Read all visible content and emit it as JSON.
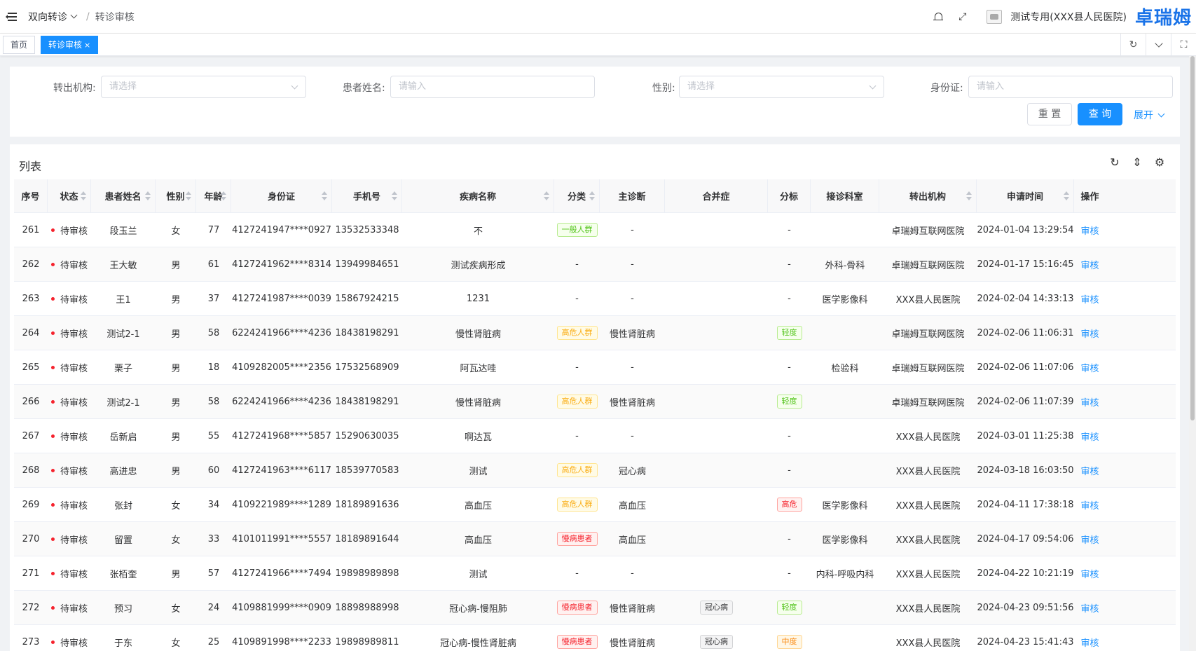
{
  "header": {
    "breadcrumb_parent": "双向转诊",
    "breadcrumb_current": "转诊审核",
    "org_name": "测试专用(XXX县人民医院)",
    "brand": "卓瑞姆"
  },
  "tabs": {
    "home": "首页",
    "active": "转诊审核",
    "close": "×"
  },
  "search": {
    "org_label": "转出机构:",
    "org_placeholder": "请选择",
    "name_label": "患者姓名:",
    "name_placeholder": "请输入",
    "gender_label": "性别:",
    "gender_placeholder": "请选择",
    "id_label": "身份证:",
    "id_placeholder": "请输入",
    "reset": "重 置",
    "query": "查 询",
    "expand": "展开"
  },
  "list": {
    "title": "列表",
    "columns": [
      "序号",
      "状态",
      "患者姓名",
      "性别",
      "年龄",
      "身份证",
      "手机号",
      "疾病名称",
      "分类",
      "主诊断",
      "合并症",
      "分标",
      "接诊科室",
      "转出机构",
      "申请时间",
      "操作"
    ],
    "rows": [
      {
        "no": "261",
        "status": "待审核",
        "name": "段玉兰",
        "gender": "女",
        "age": "77",
        "idcard": "4127241947****0927",
        "phone": "13532533348",
        "disease": "不",
        "category": "一般人群",
        "cat_color": "green",
        "diag": "-",
        "comorb": "",
        "grade": "-",
        "grade_color": "",
        "dept": "",
        "org": "卓瑞姆互联网医院",
        "time": "2024-01-04 13:29:54",
        "action": "审核"
      },
      {
        "no": "262",
        "status": "待审核",
        "name": "王大敏",
        "gender": "男",
        "age": "61",
        "idcard": "4127241962****8314",
        "phone": "13949984651",
        "disease": "测试疾病形成",
        "category": "-",
        "cat_color": "",
        "diag": "-",
        "comorb": "",
        "grade": "-",
        "grade_color": "",
        "dept": "外科-骨科",
        "org": "卓瑞姆互联网医院",
        "time": "2024-01-17 15:16:45",
        "action": "审核"
      },
      {
        "no": "263",
        "status": "待审核",
        "name": "王1",
        "gender": "男",
        "age": "37",
        "idcard": "4127241987****0039",
        "phone": "15867924215",
        "disease": "1231",
        "category": "-",
        "cat_color": "",
        "diag": "-",
        "comorb": "",
        "grade": "-",
        "grade_color": "",
        "dept": "医学影像科",
        "org": "XXX县人民医院",
        "time": "2024-02-04 14:33:13",
        "action": "审核"
      },
      {
        "no": "264",
        "status": "待审核",
        "name": "测试2-1",
        "gender": "男",
        "age": "58",
        "idcard": "6224241966****4236",
        "phone": "18438198291",
        "disease": "慢性肾脏病",
        "category": "高危人群",
        "cat_color": "yellow",
        "diag": "慢性肾脏病",
        "comorb": "",
        "grade": "轻度",
        "grade_color": "green",
        "dept": "",
        "org": "卓瑞姆互联网医院",
        "time": "2024-02-06 11:06:31",
        "action": "审核"
      },
      {
        "no": "265",
        "status": "待审核",
        "name": "栗子",
        "gender": "男",
        "age": "18",
        "idcard": "4109282005****2356",
        "phone": "17532568909",
        "disease": "阿瓦达哇",
        "category": "-",
        "cat_color": "",
        "diag": "-",
        "comorb": "",
        "grade": "-",
        "grade_color": "",
        "dept": "检验科",
        "org": "卓瑞姆互联网医院",
        "time": "2024-02-06 11:07:06",
        "action": "审核"
      },
      {
        "no": "266",
        "status": "待审核",
        "name": "测试2-1",
        "gender": "男",
        "age": "58",
        "idcard": "6224241966****4236",
        "phone": "18438198291",
        "disease": "慢性肾脏病",
        "category": "高危人群",
        "cat_color": "yellow",
        "diag": "慢性肾脏病",
        "comorb": "",
        "grade": "轻度",
        "grade_color": "green",
        "dept": "",
        "org": "卓瑞姆互联网医院",
        "time": "2024-02-06 11:07:39",
        "action": "审核"
      },
      {
        "no": "267",
        "status": "待审核",
        "name": "岳新启",
        "gender": "男",
        "age": "55",
        "idcard": "4127241968****5857",
        "phone": "15290630035",
        "disease": "啊达瓦",
        "category": "-",
        "cat_color": "",
        "diag": "-",
        "comorb": "",
        "grade": "-",
        "grade_color": "",
        "dept": "",
        "org": "XXX县人民医院",
        "time": "2024-03-01 11:25:38",
        "action": "审核"
      },
      {
        "no": "268",
        "status": "待审核",
        "name": "高进忠",
        "gender": "男",
        "age": "60",
        "idcard": "4127241963****6117",
        "phone": "18539770583",
        "disease": "测试",
        "category": "高危人群",
        "cat_color": "yellow",
        "diag": "冠心病",
        "comorb": "",
        "grade": "-",
        "grade_color": "",
        "dept": "",
        "org": "XXX县人民医院",
        "time": "2024-03-18 16:03:50",
        "action": "审核"
      },
      {
        "no": "269",
        "status": "待审核",
        "name": "张封",
        "gender": "女",
        "age": "34",
        "idcard": "4109221989****1289",
        "phone": "18189891636",
        "disease": "高血压",
        "category": "高危人群",
        "cat_color": "yellow",
        "diag": "高血压",
        "comorb": "",
        "grade": "高危",
        "grade_color": "red",
        "dept": "医学影像科",
        "org": "XXX县人民医院",
        "time": "2024-04-11 17:38:18",
        "action": "审核"
      },
      {
        "no": "270",
        "status": "待审核",
        "name": "留置",
        "gender": "女",
        "age": "33",
        "idcard": "4101011991****5557",
        "phone": "18189891644",
        "disease": "高血压",
        "category": "慢病患者",
        "cat_color": "red",
        "diag": "高血压",
        "comorb": "",
        "grade": "-",
        "grade_color": "",
        "dept": "医学影像科",
        "org": "XXX县人民医院",
        "time": "2024-04-17 09:54:06",
        "action": "审核"
      },
      {
        "no": "271",
        "status": "待审核",
        "name": "张栢奎",
        "gender": "男",
        "age": "57",
        "idcard": "4127241966****7494",
        "phone": "19898989898",
        "disease": "测试",
        "category": "-",
        "cat_color": "",
        "diag": "-",
        "comorb": "",
        "grade": "-",
        "grade_color": "",
        "dept": "内科-呼吸内科",
        "org": "XXX县人民医院",
        "time": "2024-04-22 10:21:19",
        "action": "审核"
      },
      {
        "no": "272",
        "status": "待审核",
        "name": "预习",
        "gender": "女",
        "age": "24",
        "idcard": "4109881999****0909",
        "phone": "18898988998",
        "disease": "冠心病-慢阻肺",
        "category": "慢病患者",
        "cat_color": "red",
        "diag": "慢性肾脏病",
        "comorb": "冠心病",
        "grade": "轻度",
        "grade_color": "green",
        "dept": "",
        "org": "XXX县人民医院",
        "time": "2024-04-23 09:51:56",
        "action": "审核"
      },
      {
        "no": "273",
        "status": "待审核",
        "name": "于东",
        "gender": "女",
        "age": "25",
        "idcard": "4109891998****2233",
        "phone": "19898989811",
        "disease": "冠心病-慢性肾脏病",
        "category": "慢病患者",
        "cat_color": "red",
        "diag": "慢性肾脏病",
        "comorb": "冠心病",
        "grade": "中度",
        "grade_color": "orange",
        "dept": "",
        "org": "XXX县人民医院",
        "time": "2024-04-23 15:41:43",
        "action": "审核"
      }
    ]
  }
}
